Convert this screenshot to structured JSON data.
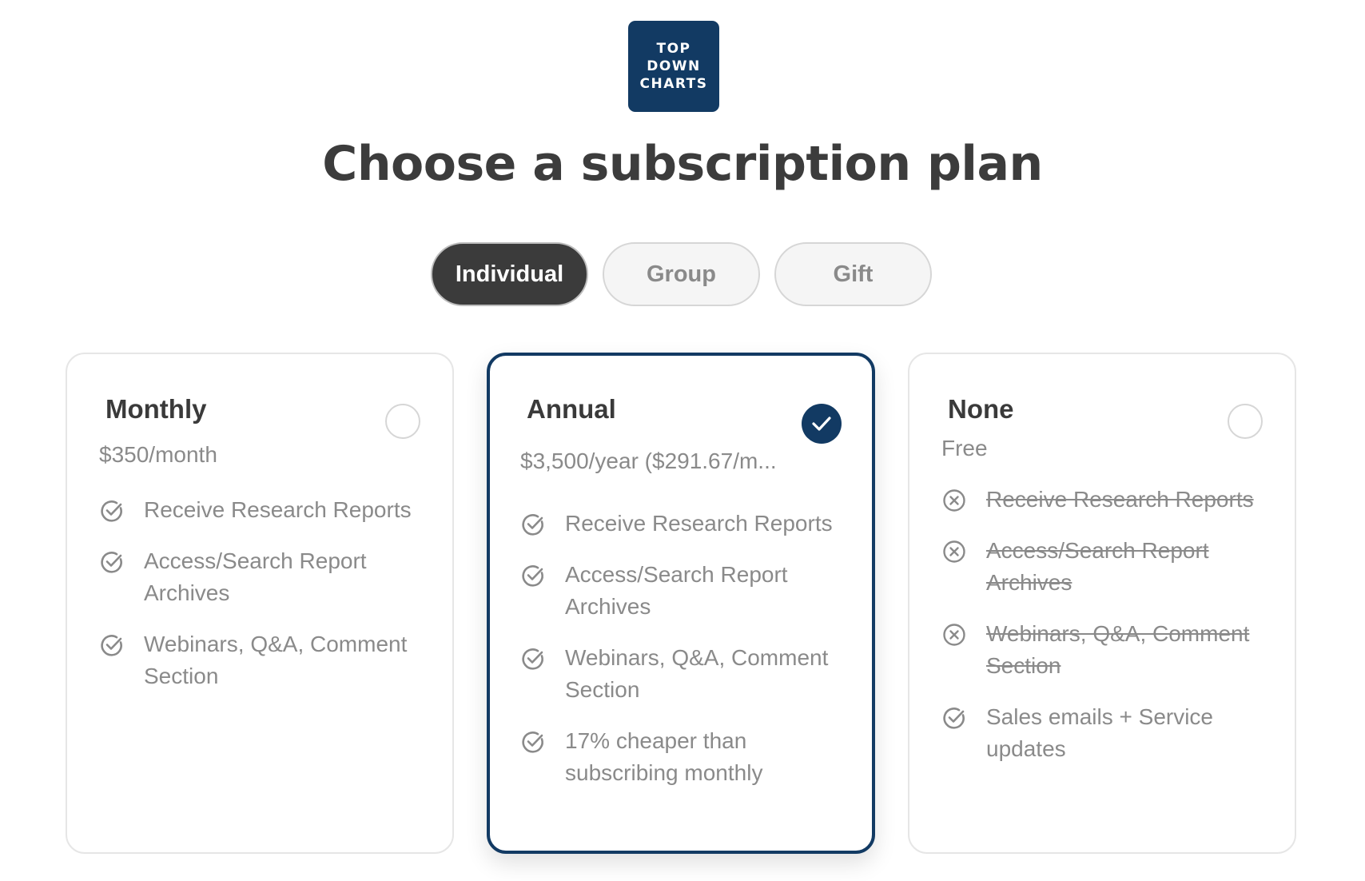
{
  "brand": {
    "logo_lines": [
      "TOP",
      "DOWN",
      "CHARTS"
    ],
    "color": "#123a63"
  },
  "page_title": "Choose a subscription plan",
  "tabs": [
    {
      "label": "Individual",
      "active": true
    },
    {
      "label": "Group",
      "active": false
    },
    {
      "label": "Gift",
      "active": false
    }
  ],
  "plans": [
    {
      "name": "Monthly",
      "price": "$350/month",
      "selected": false,
      "features": [
        {
          "text": "Receive Research Reports",
          "included": true
        },
        {
          "text": "Access/Search Report Archives",
          "included": true
        },
        {
          "text": "Webinars, Q&A, Comment Section",
          "included": true
        }
      ]
    },
    {
      "name": "Annual",
      "price": "$3,500/year ($291.67/m...",
      "selected": true,
      "features": [
        {
          "text": "Receive Research Reports",
          "included": true
        },
        {
          "text": "Access/Search Report Archives",
          "included": true
        },
        {
          "text": "Webinars, Q&A, Comment Section",
          "included": true
        },
        {
          "text": "17% cheaper than subscribing monthly",
          "included": true
        }
      ]
    },
    {
      "name": "None",
      "price": "Free",
      "selected": false,
      "features": [
        {
          "text": "Receive Research Reports",
          "included": false
        },
        {
          "text": "Access/Search Report Archives",
          "included": false
        },
        {
          "text": "Webinars, Q&A, Comment Section",
          "included": false
        },
        {
          "text": "Sales emails + Service updates",
          "included": true
        }
      ]
    }
  ],
  "icons": {
    "included": "check-circle-icon",
    "excluded": "x-circle-icon",
    "selected": "checkmark-icon"
  },
  "colors": {
    "accent": "#123a63",
    "tab_active_bg": "#3b3b3b",
    "muted_text": "#8a8a8a"
  }
}
